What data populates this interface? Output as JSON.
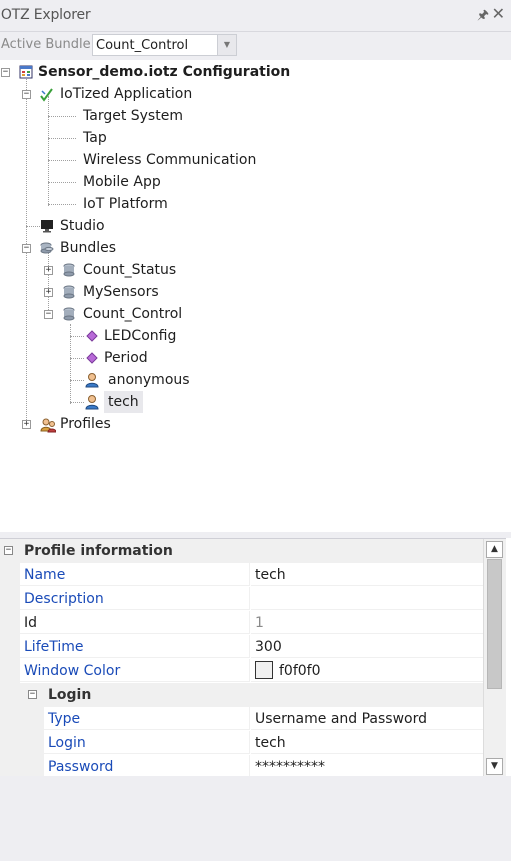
{
  "panel": {
    "title": "IOTZ Explorer",
    "pin_icon": "pin-icon",
    "close_icon": "close-icon"
  },
  "active_bundle": {
    "label": "Active Bundle:",
    "value": "Count_Control"
  },
  "tree": {
    "root": "Sensor_demo.iotz Configuration",
    "app": "IoTized Application",
    "app_children": [
      "Target System",
      "Tap",
      "Wireless Communication",
      "Mobile App",
      "IoT Platform"
    ],
    "studio": "Studio",
    "bundles": "Bundles",
    "bundle_items": [
      "Count_Status",
      "MySensors",
      "Count_Control"
    ],
    "count_control_children": [
      "LEDConfig",
      "Period",
      "anonymous",
      "tech"
    ],
    "profiles": "Profiles"
  },
  "properties": {
    "category": "Profile information",
    "rows": [
      {
        "name": "Name",
        "value": "tech"
      },
      {
        "name": "Description",
        "value": ""
      },
      {
        "name": "Id",
        "value": "1"
      },
      {
        "name": "LifeTime",
        "value": "300"
      },
      {
        "name": "Window Color",
        "value": "f0f0f0",
        "swatch": "#f0f0f0"
      }
    ],
    "subcategory": "Login",
    "login_rows": [
      {
        "name": "Type",
        "value": "Username and Password"
      },
      {
        "name": "Login",
        "value": "tech"
      },
      {
        "name": "Password",
        "value": "**********"
      }
    ]
  },
  "colors": {
    "link": "#1a4bb8",
    "panel_bg": "#eeeef2"
  }
}
